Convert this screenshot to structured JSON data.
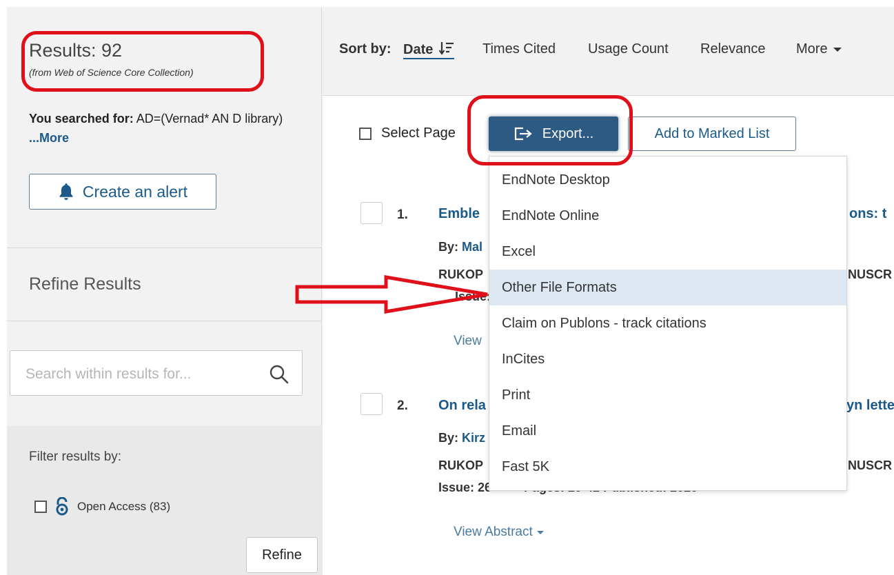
{
  "sidebar": {
    "results_label": "Results: 92",
    "results_source": "(from Web of Science Core Collection)",
    "searched_label": "You searched for:",
    "searched_query": "AD=(Vernad* AN D library)",
    "more_link": "...More",
    "create_alert_label": "Create an alert",
    "refine_results_title": "Refine Results",
    "search_placeholder": "Search within results for...",
    "filter_label": "Filter results by:",
    "open_access_label": "Open Access (83)",
    "refine_button": "Refine"
  },
  "sortbar": {
    "label": "Sort by:",
    "options": [
      "Date",
      "Times Cited",
      "Usage Count",
      "Relevance",
      "More"
    ]
  },
  "toolbar": {
    "select_page": "Select Page",
    "export_label": "Export...",
    "marked_list_label": "Add to Marked List"
  },
  "records": [
    {
      "number": "1.",
      "title_start": "Emble",
      "title_end": "ons: t",
      "by_label": "By:",
      "author_start": "Mal",
      "source_start": "RUKOP",
      "source_end": "NUSCR",
      "issue_start": "Issue:",
      "view_abstract": "View"
    },
    {
      "number": "2.",
      "title_start": "On rela",
      "title_end": "yn lette",
      "by_label": "By:",
      "author_start": "Kirz",
      "source_start": "RUKOP",
      "source_end": "NUSCR",
      "issue_start": "Issue: 26",
      "issue_end": "Pages: 29-42  Published: 2020",
      "view_abstract": "View Abstract"
    }
  ],
  "export_menu": {
    "items": [
      "EndNote Desktop",
      "EndNote Online",
      "Excel",
      "Other File Formats",
      "Claim on Publons - track citations",
      "InCites",
      "Print",
      "Email",
      "Fast 5K"
    ],
    "highlighted": "Other File Formats"
  },
  "colors": {
    "accent": "#1a5a8a",
    "export_button": "#2d5a82",
    "annotation_red": "#e0101a",
    "menu_highlight": "#dde8f3"
  }
}
